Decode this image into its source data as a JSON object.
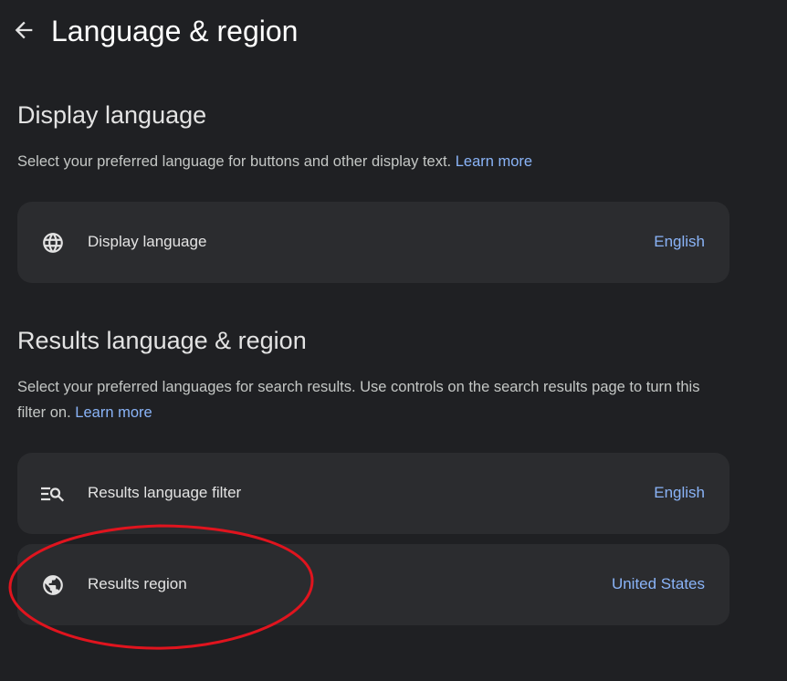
{
  "header": {
    "title": "Language & region"
  },
  "display_language_section": {
    "title": "Display language",
    "description": "Select your preferred language for buttons and other display text.",
    "learn_more": "Learn more",
    "row": {
      "label": "Display language",
      "value": "English",
      "icon": "globe-icon"
    }
  },
  "results_section": {
    "title": "Results language & region",
    "description": "Select your preferred languages for search results. Use controls on the search results page to turn this filter on.",
    "learn_more": "Learn more",
    "rows": [
      {
        "label": "Results language filter",
        "value": "English",
        "icon": "filter-search-icon"
      },
      {
        "label": "Results region",
        "value": "United States",
        "icon": "earth-icon"
      }
    ]
  },
  "colors": {
    "background": "#1f2023",
    "card": "#2b2c2f",
    "link": "#8ab4f8",
    "annotation": "#e0141e"
  }
}
